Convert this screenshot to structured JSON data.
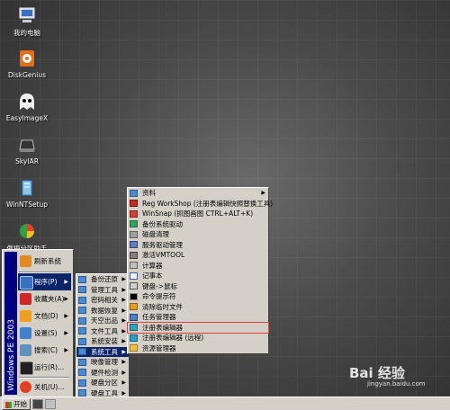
{
  "desktop": {
    "icons": [
      {
        "label": "我的电脑",
        "icon": "computer-icon"
      },
      {
        "label": "DiskGenius",
        "icon": "diskgenius-icon"
      },
      {
        "label": "EasyImageX",
        "icon": "easyimagex-icon"
      },
      {
        "label": "SkyIAR",
        "icon": "skyiar-icon"
      },
      {
        "label": "WinNTSetup",
        "icon": "winntsetup-icon"
      },
      {
        "label": "傲梅分区助手",
        "icon": "partition-assistant-icon"
      }
    ]
  },
  "start_menu": {
    "side_banner": "Windows PE 2003",
    "items": [
      {
        "label": "刷新系统",
        "icon": "refresh-icon",
        "submenu": false
      },
      {
        "label": "程序(P)",
        "icon": "programs-icon",
        "submenu": true
      },
      {
        "label": "收藏夹(A)",
        "icon": "favorites-icon",
        "submenu": true
      },
      {
        "label": "文档(D)",
        "icon": "documents-icon",
        "submenu": true
      },
      {
        "label": "设置(S)",
        "icon": "settings-icon",
        "submenu": true
      },
      {
        "label": "搜索(C)",
        "icon": "search-icon",
        "submenu": true
      },
      {
        "label": "运行(R)...",
        "icon": "run-icon",
        "submenu": false
      },
      {
        "label": "关机(U)...",
        "icon": "shutdown-icon",
        "submenu": false
      }
    ]
  },
  "programs_menu": {
    "items": [
      {
        "label": "备份还原"
      },
      {
        "label": "管理工具"
      },
      {
        "label": "密码相关"
      },
      {
        "label": "数据恢复"
      },
      {
        "label": "天空出品"
      },
      {
        "label": "文件工具"
      },
      {
        "label": "系统安装"
      },
      {
        "label": "系统工具"
      },
      {
        "label": "映像管理"
      },
      {
        "label": "硬件检测"
      },
      {
        "label": "硬盘分区"
      },
      {
        "label": "硬盘工具"
      }
    ]
  },
  "system_tools_menu": {
    "items": [
      {
        "label": "资料",
        "submenu": true
      },
      {
        "label": "Reg WorkShop (注册表编辑快照替换工具)",
        "submenu": false
      },
      {
        "label": "WinSnap (抓图画图 CTRL+ALT+K)",
        "submenu": false
      },
      {
        "label": "备份系统驱动",
        "submenu": false
      },
      {
        "label": "磁盘清理",
        "submenu": false
      },
      {
        "label": "服务驱动管理",
        "submenu": false
      },
      {
        "label": "激活VMTOOL",
        "submenu": false
      },
      {
        "label": "计算器",
        "submenu": false
      },
      {
        "label": "记事本",
        "submenu": false
      },
      {
        "label": "键盘->鼠标",
        "submenu": false
      },
      {
        "label": "命令提示符",
        "submenu": false
      },
      {
        "label": "清除临时文件",
        "submenu": false
      },
      {
        "label": "任务管理器",
        "submenu": false
      },
      {
        "label": "注册表编辑器",
        "submenu": false
      },
      {
        "label": "注册表编辑器 (远程)",
        "submenu": false
      },
      {
        "label": "资源管理器",
        "submenu": false
      }
    ]
  },
  "taskbar": {
    "start_label": "开始"
  },
  "watermark": {
    "brand": "Bai 经验",
    "url": "jingyan.baidu.com"
  },
  "colors": {
    "highlight": "#0a246a",
    "menu_bg": "#d4d0c8",
    "side_banner": "#000080",
    "callout": "#e04040"
  }
}
